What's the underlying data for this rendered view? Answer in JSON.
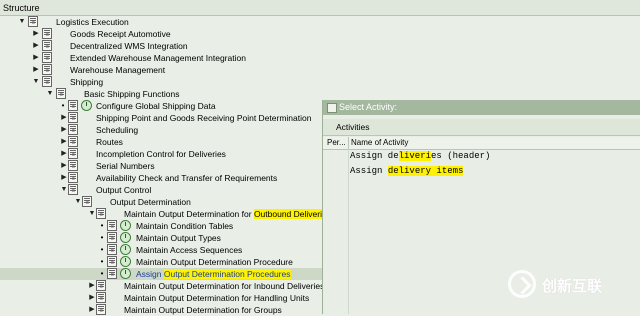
{
  "structure_header": "Structure",
  "tree": [
    {
      "text": "Logistics Execution"
    },
    {
      "text": "Goods Receipt Automotive"
    },
    {
      "text": "Decentralized WMS Integration"
    },
    {
      "text": "Extended Warehouse Management Integration"
    },
    {
      "text": "Warehouse Management"
    },
    {
      "text": "Shipping"
    },
    {
      "text": "Basic Shipping Functions"
    },
    {
      "text": "Configure Global Shipping Data"
    },
    {
      "text": "Shipping Point and Goods Receiving Point Determination"
    },
    {
      "text": "Scheduling"
    },
    {
      "text": "Routes"
    },
    {
      "text": "Incompletion Control for Deliveries"
    },
    {
      "text": "Serial Numbers"
    },
    {
      "text": "Availability Check and Transfer of Requirements"
    },
    {
      "text": "Output Control"
    },
    {
      "text": "Output Determination"
    },
    {
      "text": "Maintain Output Determination for ",
      "hl": "Outbound Deliveries"
    },
    {
      "text": "Maintain Condition Tables"
    },
    {
      "text": "Maintain Output Types"
    },
    {
      "text": "Maintain Access Sequences"
    },
    {
      "text": "Maintain Output Determination Procedure"
    },
    {
      "text": "Assign ",
      "hl": "Output Determination Procedures"
    },
    {
      "text": "Maintain Output Determination for Inbound Deliveries"
    },
    {
      "text": "Maintain Output Determination for Handling Units"
    },
    {
      "text": "Maintain Output Determination for Groups"
    }
  ],
  "dialog": {
    "title": "Select Activity:",
    "tab": "Activities",
    "col_perform": "Per...",
    "col_name": "Name of Activity",
    "activities": [
      {
        "pre": "Assign de",
        "hl": "liveri",
        "post": "es (header)"
      },
      {
        "pre": "Assign ",
        "hl": "delivery items",
        "post": ""
      }
    ]
  },
  "watermark": "创新互联"
}
